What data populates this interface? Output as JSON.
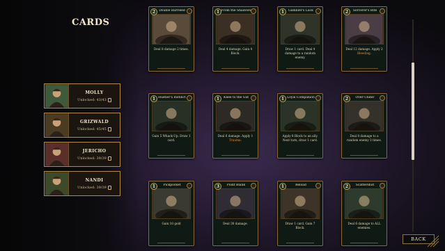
{
  "screen": {
    "title": "CARDS"
  },
  "characters": [
    {
      "name": "MOLLY",
      "unlocked": "Unlocked: 43/43"
    },
    {
      "name": "GRIZWALD",
      "unlocked": "Unlocked: 45/45"
    },
    {
      "name": "JERICHO",
      "unlocked": "Unlocked: 39/39"
    },
    {
      "name": "NANDI",
      "unlocked": "Unlocked: 39/39"
    }
  ],
  "cards": [
    {
      "name": "Double Barreled",
      "cost": "2",
      "desc": [
        "Deal ",
        "8",
        " damage 2 times."
      ],
      "art": "#5a4a3a"
    },
    {
      "name": "From the Shadows",
      "cost": "1",
      "desc": [
        "Deal ",
        "4",
        " damage. Gain 4 Block."
      ],
      "art": "#3b2f24"
    },
    {
      "name": "Gambler's Luck",
      "cost": "1",
      "desc": [
        "Draw 1 card. Deal ",
        "4",
        " damage to a random enemy."
      ],
      "art": "#2f3328"
    },
    {
      "name": "Sorcerer's Bite",
      "cost": "2",
      "desc": [
        "Deal ",
        "12",
        " damage. Apply 2 ",
        "Bleeding",
        "."
      ],
      "art": "#4a3d44"
    },
    {
      "name": "Hustler's Instinct",
      "cost": "1",
      "desc": [
        "Gain 5 Whack-Up. Draw 1 card."
      ],
      "art": "#283026"
    },
    {
      "name": "Knee to the Gut",
      "cost": "1",
      "desc": [
        "Deal ",
        "6",
        " damage. Apply 1 ",
        "Trauma",
        "."
      ],
      "art": "#2d2a25"
    },
    {
      "name": "Loyal Companion",
      "cost": "1",
      "desc": [
        "Apply 8 Block to an ally. Next turn, draw 1 card."
      ],
      "art": "#2a3326"
    },
    {
      "name": "Over-Under",
      "cost": "2",
      "desc": [
        "Deal ",
        "8",
        " damage to a random enemy 3 times."
      ],
      "art": "#34302a"
    },
    {
      "name": "Pickpocket",
      "cost": "1",
      "desc": [
        "Gain 10 ",
        "gold",
        ""
      ],
      "art": "#3a3a30"
    },
    {
      "name": "Point Blank",
      "cost": "3",
      "desc": [
        "Deal ",
        "30",
        " damage."
      ],
      "art": "#2f2c33"
    },
    {
      "name": "Reload",
      "cost": "1",
      "desc": [
        "Draw 1 card. Gain 7 Block."
      ],
      "art": "#3d3427"
    },
    {
      "name": "Scattershot",
      "cost": "2",
      "desc": [
        "Deal ",
        "6",
        " damage to ALL enemies."
      ],
      "art": "#2e3a2c"
    }
  ],
  "footer": {
    "back_label": "BACK"
  },
  "colors": {
    "gold_border": "#b38b46",
    "card_bg": "#0f1a14",
    "highlight": "#e88a3a"
  }
}
